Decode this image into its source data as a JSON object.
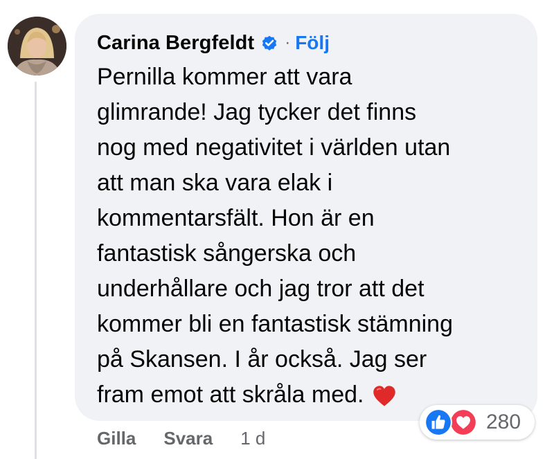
{
  "comment": {
    "author": "Carina Bergfeldt",
    "separator": "·",
    "follow_label": "Följ",
    "verified_icon": "verified-badge-icon",
    "lines": [
      "Pernilla kommer att vara",
      "glimrande! Jag tycker det finns",
      "nog med negativitet i världen utan",
      "att man ska vara elak i",
      "kommentarsfält. Hon är en",
      "fantastisk sångerska och",
      "underhållare och jag tror att det",
      "kommer bli en fantastisk stämning",
      "på Skansen. I år också. Jag ser",
      "fram emot att skråla med."
    ],
    "emoji_icon": "red-heart-icon"
  },
  "reactions": {
    "icons": [
      "like-icon",
      "love-icon"
    ],
    "count": "280"
  },
  "actions": {
    "like_label": "Gilla",
    "reply_label": "Svara",
    "timestamp": "1 d"
  },
  "colors": {
    "bubble": "#f0f2f5",
    "link": "#1877f2",
    "muted": "#65676b",
    "text": "#050505",
    "heart": "#e02a2a"
  }
}
